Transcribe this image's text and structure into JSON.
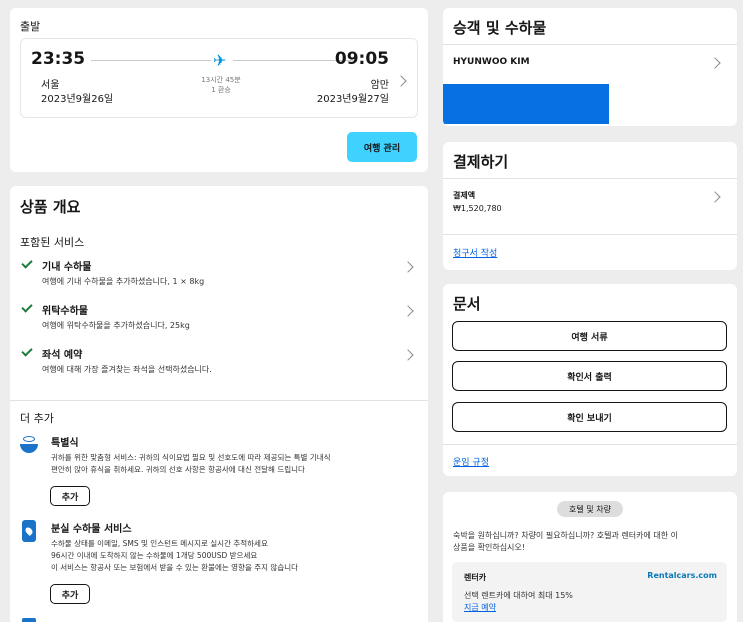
{
  "departure": {
    "heading": "출발",
    "dep_time": "23:35",
    "arr_time": "09:05",
    "duration": "13시간 45분",
    "stops": "1 환승",
    "dep_city": "서울",
    "arr_city": "암만",
    "dep_date": "2023년9월26일",
    "arr_date": "2023년9월27일",
    "manage_button": "여행 관리"
  },
  "overview": {
    "title": "상품 개요",
    "included_title": "포함된 서비스",
    "included": [
      {
        "title": "기내 수하물",
        "desc": "여행에 기내 수하물을 추가하셨습니다, 1 × 8kg"
      },
      {
        "title": "위탁수하물",
        "desc": "여행에 위탁수하물을 추가하셨습니다, 25kg"
      },
      {
        "title": "좌석 예약",
        "desc": "여행에 대해 가장 즐겨찾는 좌석을 선택하셨습니다."
      }
    ],
    "more_title": "더 추가",
    "addons": [
      {
        "title": "특별식",
        "desc1": "귀하를 위한 맞춤형 서비스: 귀하의 식이요법 필요 및 선호도에 따라 제공되는 특별 기내식",
        "desc2": "편안히 앉아 휴식을 취하세요. 귀하의 선호 사항은 항공사에 대신 전달해 드립니다",
        "desc3": "",
        "button": "추가"
      },
      {
        "title": "분실 수하물 서비스",
        "desc1": "수하물 상태를 이메일, SMS 및 인스턴트 메시지로 실시간 추적하세요",
        "desc2": "96시간 이내에 도착하지 않는 수하물에 1개당 500USD 받으세요",
        "desc3": "이 서비스는 항공사 또는 보험에서 받을 수 있는 환불에는 영향을 주지 않습니다",
        "button": "추가"
      }
    ]
  },
  "passengers": {
    "title": "승객 및 수하물",
    "name": "HYUNWOO KIM",
    "accent_color": "#0770e3"
  },
  "payment": {
    "title": "결제하기",
    "label": "결제액",
    "amount": "₩1,520,780",
    "invoice_link": "청구서 작성"
  },
  "documents": {
    "title": "문서",
    "buttons": [
      "여행 서류",
      "확인서 출력",
      "확인 보내기"
    ],
    "rules_link": "운임 규정"
  },
  "hotel": {
    "tab_label": "호텔 및 차량",
    "text1": "숙박을 원하십니까? 차량이 필요하십니까? 호텔과 렌터카에 대한 이",
    "text2": "상품을 확인하십시오!",
    "rental_title": "렌터카",
    "rental_brand": "Rentalcars.com",
    "rental_desc": "선택 렌트카에 대하여 최대 15%",
    "rental_link": "지금 예약"
  }
}
